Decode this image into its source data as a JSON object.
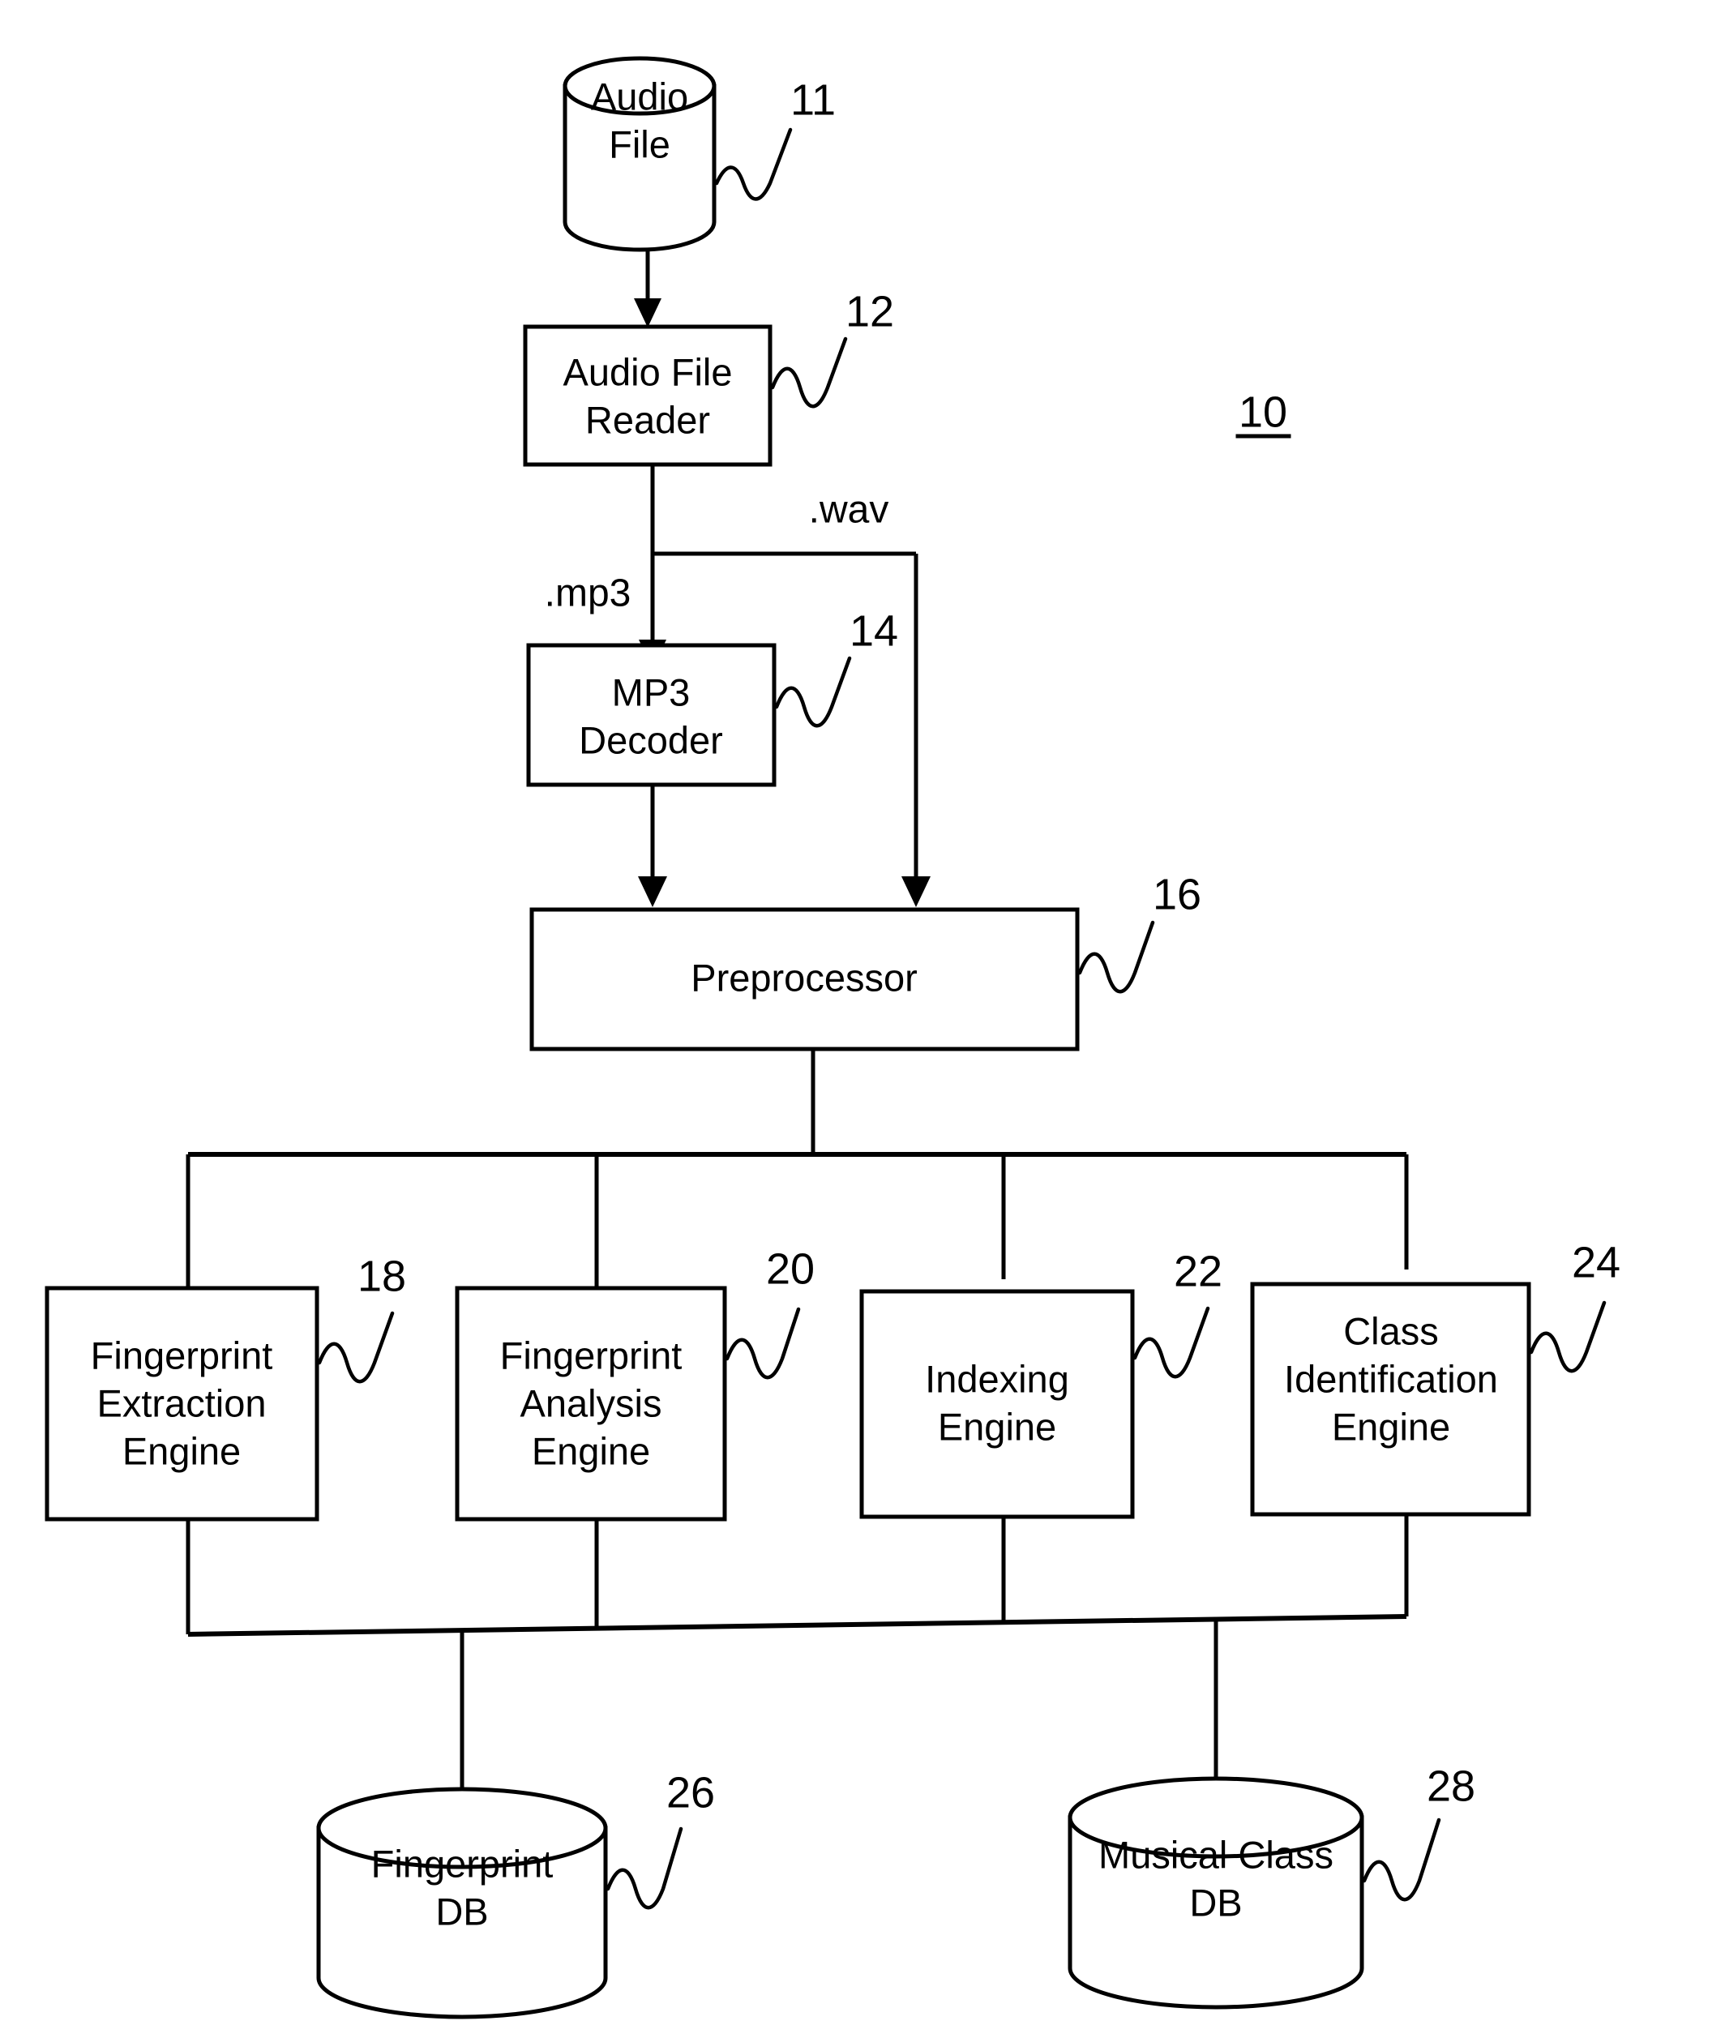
{
  "figure": {
    "system_reference": "10"
  },
  "nodes": {
    "audio_file": {
      "label_line1": "Audio",
      "label_line2": "File",
      "ref": "11",
      "shape": "cylinder"
    },
    "audio_file_reader": {
      "label_line1": "Audio File",
      "label_line2": "Reader",
      "ref": "12",
      "shape": "rectangle"
    },
    "mp3_decoder": {
      "label_line1": "MP3",
      "label_line2": "Decoder",
      "ref": "14",
      "shape": "rectangle"
    },
    "preprocessor": {
      "label_line1": "Preprocessor",
      "ref": "16",
      "shape": "rectangle"
    },
    "fingerprint_extraction_engine": {
      "label_line1": "Fingerprint",
      "label_line2": "Extraction",
      "label_line3": "Engine",
      "ref": "18",
      "shape": "rectangle"
    },
    "fingerprint_analysis_engine": {
      "label_line1": "Fingerprint",
      "label_line2": "Analysis",
      "label_line3": "Engine",
      "ref": "20",
      "shape": "rectangle"
    },
    "indexing_engine": {
      "label_line1": "Indexing",
      "label_line2": "Engine",
      "ref": "22",
      "shape": "rectangle"
    },
    "class_identification_engine": {
      "label_line1": "Class",
      "label_line2": "Identification",
      "label_line3": "Engine",
      "ref": "24",
      "shape": "rectangle"
    },
    "fingerprint_db": {
      "label_line1": "Fingerprint",
      "label_line2": "DB",
      "ref": "26",
      "shape": "cylinder"
    },
    "musical_class_db": {
      "label_line1": "Musical Class",
      "label_line2": "DB",
      "ref": "28",
      "shape": "cylinder"
    }
  },
  "edge_labels": {
    "mp3_branch": ".mp3",
    "wav_branch": ".wav"
  },
  "colors": {
    "stroke": "#000000",
    "background": "#ffffff"
  }
}
